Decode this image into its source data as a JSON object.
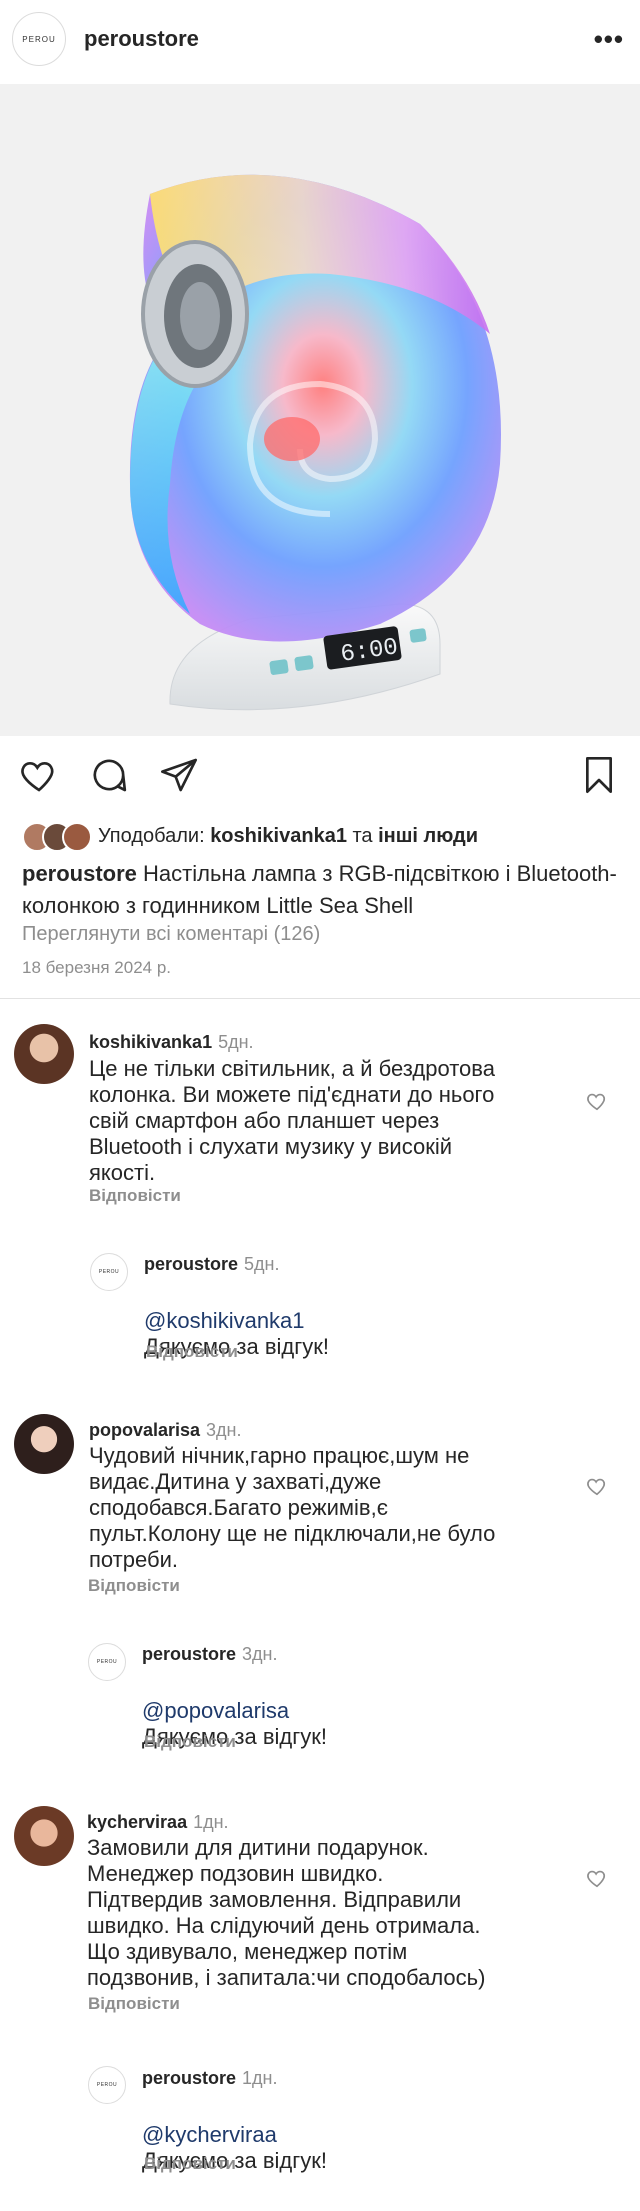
{
  "header": {
    "brand_logo_text": "PEROU",
    "username": "peroustore",
    "more_icon": "•••"
  },
  "post": {
    "photo": {
      "clock_display": "6:00"
    },
    "icons": [
      "heart-icon",
      "comment-icon",
      "share-icon",
      "bookmark-icon"
    ],
    "likes": {
      "prefix": "Уподобали: ",
      "user": "koshikivanka1",
      "middle": " та ",
      "others": "інші люди"
    },
    "caption": {
      "user": "peroustore",
      "text": " Настільна лампа з RGB-підсвіткою і Bluetooth-колонкою з годинником Little Sea Shell"
    },
    "view_comments": "Переглянути всі коментарі (126)",
    "date": "18 березня 2024 р."
  },
  "comments": [
    {
      "user": "koshikivanka1",
      "time": "5дн.",
      "text": "Це не тільки світильник, а й бездротова\nколонка. Ви можете під'єднати до нього\nсвій смартфон або планшет через\nBluetooth і слухати музику у високій\nякості.",
      "reply_label": "Відповісти",
      "response": {
        "user": "peroustore",
        "time": "5дн.",
        "logo": "PEROU",
        "mention": "@koshikivanka1",
        "text": "Дякуємо за відгук!",
        "reply_label": "Відповісти"
      }
    },
    {
      "user": "popovalarisa",
      "time": "3дн.",
      "text": "Чудовий нічник,гарно працює,шум не\nвидає.Дитина у захваті,дуже\nсподобався.Багато режимів,є\nпульт.Колону ще не підключали,не було\nпотреби.",
      "reply_label": "Відповісти",
      "response": {
        "user": "peroustore",
        "time": "3дн.",
        "logo": "PEROU",
        "mention": "@popovalarisa",
        "text": "Дякуємо за відгук!",
        "reply_label": "Відповісти"
      }
    },
    {
      "user": "kycherviraa",
      "time": "1дн.",
      "text": "Замовили для дитини подарунок.\nМенеджер подзовин швидко.\nПідтвердив замовлення. Відправили\nшвидко. На слідуючий день отримала.\nЩо здивувало, менеджер потім\nподзвонив, і запитала:чи сподобалось)",
      "reply_label": "Відповісти",
      "response": {
        "user": "peroustore",
        "time": "1дн.",
        "logo": "PEROU",
        "mention": "@kycherviraa",
        "text": "Дякуємо за відгук!",
        "reply_label": "Відповісти"
      }
    }
  ]
}
